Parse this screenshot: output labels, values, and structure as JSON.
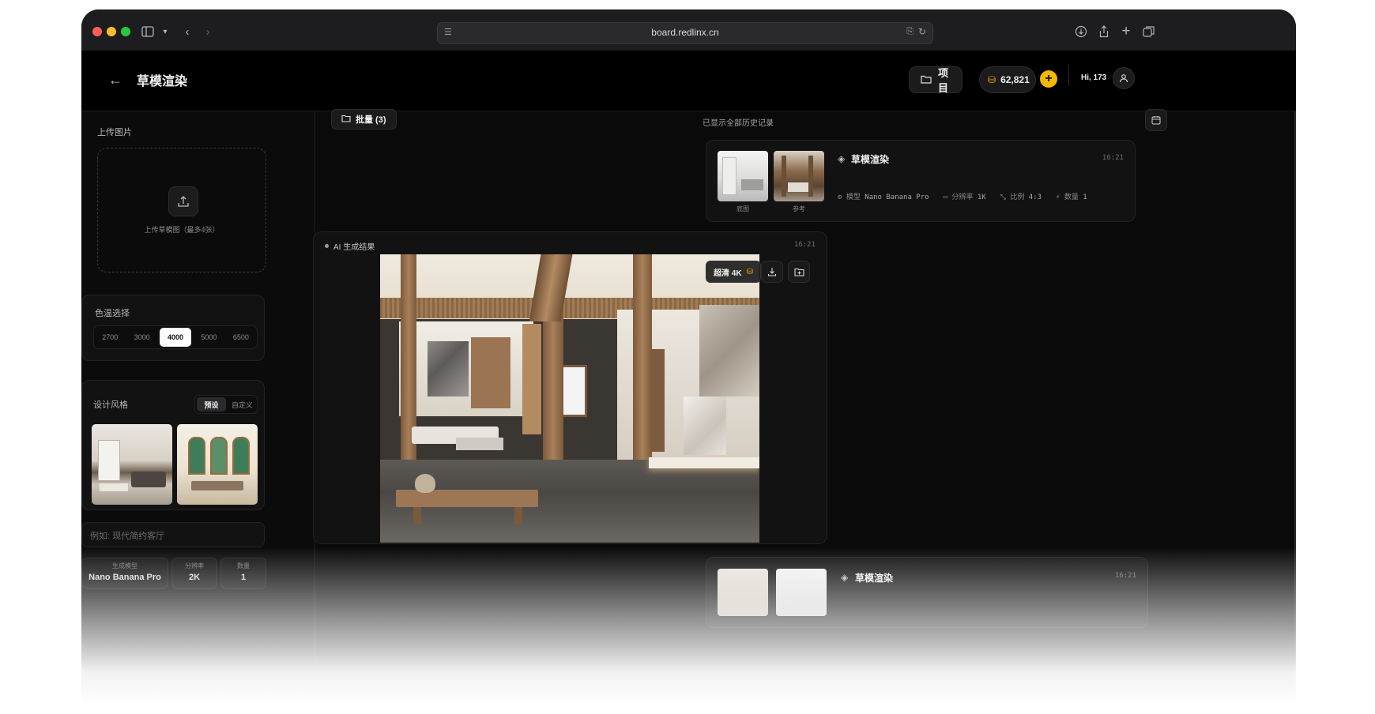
{
  "browser": {
    "url": "board.redlinx.cn"
  },
  "header": {
    "back_icon": "arrow-left-icon",
    "title": "草模渲染",
    "projects_label": "项目",
    "credits": "62,821",
    "add_label": "+",
    "greeting": "Hi, 173"
  },
  "sidebar": {
    "upload": {
      "label": "上传图片",
      "hint": "上传草模图（最多4张）"
    },
    "color_temp": {
      "label": "色温选择",
      "options": [
        "2700",
        "3000",
        "4000",
        "5000",
        "6500"
      ],
      "selected": "4000"
    },
    "style": {
      "label": "设计风格",
      "tabs": [
        "预设",
        "自定义"
      ],
      "active_tab": "预设"
    },
    "prompt": {
      "placeholder": "例如: 现代简约客厅"
    },
    "settings": [
      {
        "label": "生成模型",
        "value": "Nano Banana Pro"
      },
      {
        "label": "分辨率",
        "value": "2K"
      },
      {
        "label": "数量",
        "value": "1"
      }
    ]
  },
  "main": {
    "batch_label": "批量 (3)",
    "history_note": "已显示全部历史记录",
    "task": {
      "title": "草模渲染",
      "time": "16:21",
      "thumb_labels": [
        "底图",
        "参考"
      ],
      "meta": [
        {
          "key": "模型",
          "value": "Nano Banana Pro"
        },
        {
          "key": "分辨率",
          "value": "1K"
        },
        {
          "key": "比例",
          "value": "4:3"
        },
        {
          "key": "数量",
          "value": "1"
        }
      ]
    },
    "result": {
      "label": "AI 生成结果",
      "time": "16:21",
      "upscale_label": "超清 4K"
    },
    "task2": {
      "title": "草模渲染",
      "time": "16:21"
    }
  },
  "colors": {
    "accent": "#f5b800",
    "selected_chip": "#ffffff",
    "bg": "#0a0a0a"
  }
}
